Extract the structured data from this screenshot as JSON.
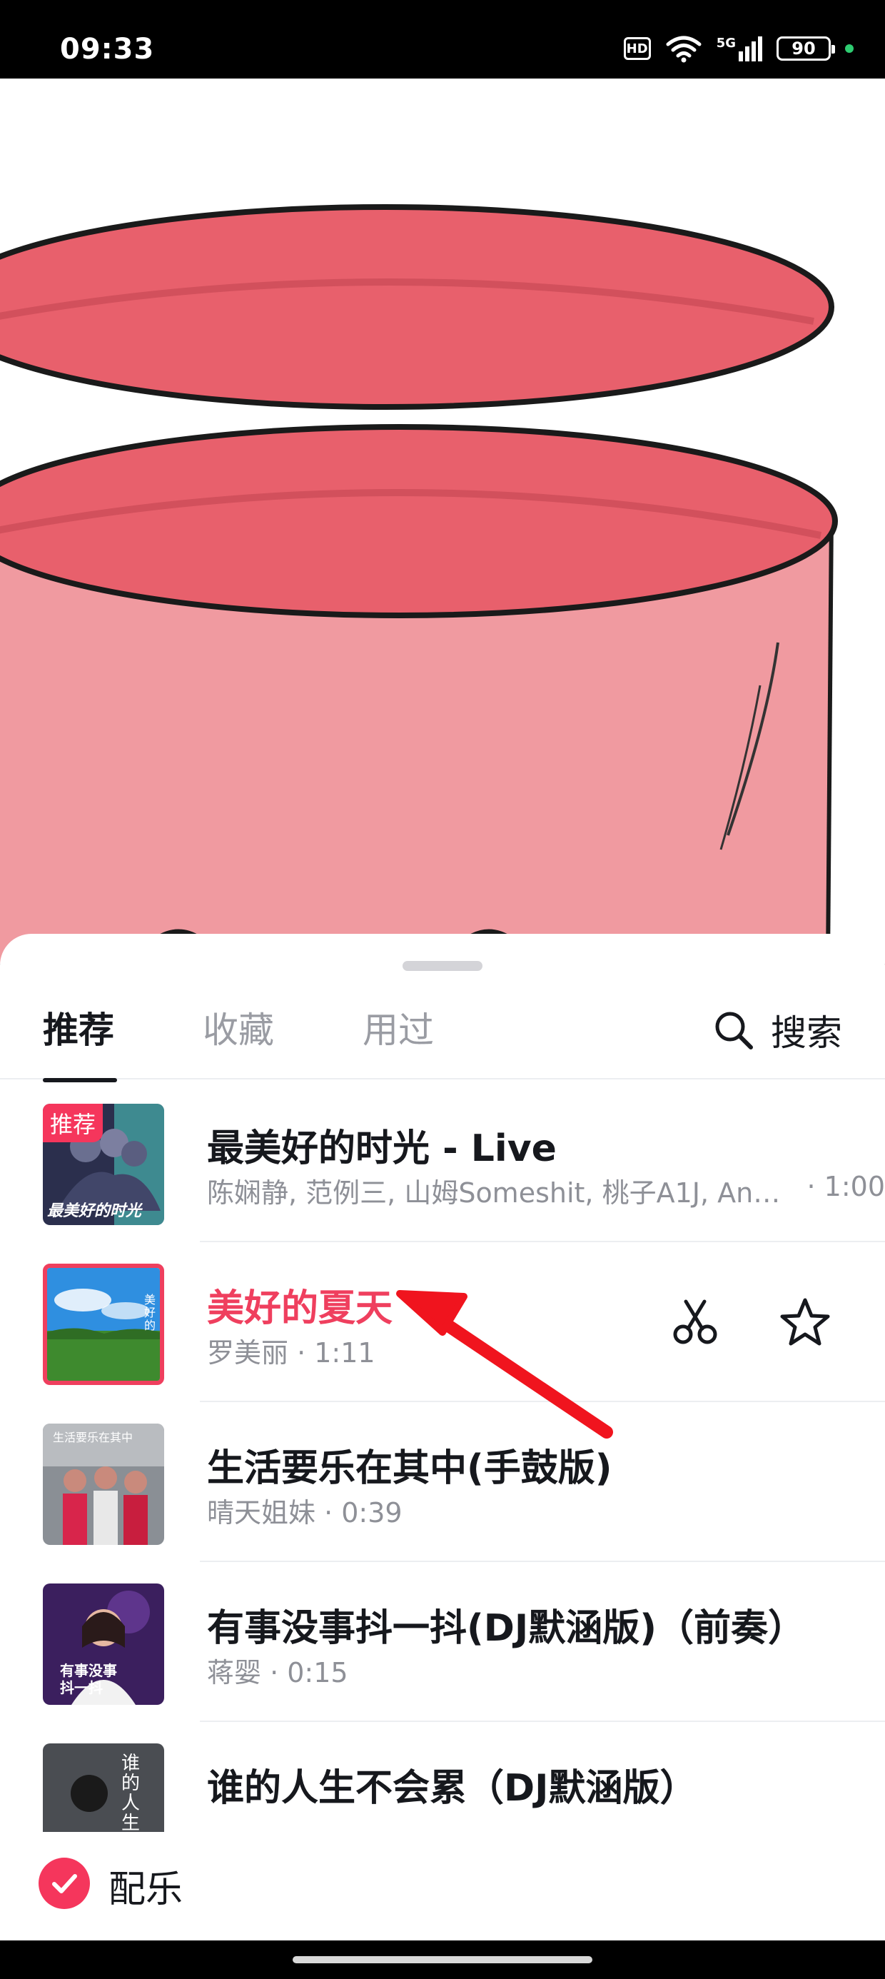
{
  "status_bar": {
    "time": "09:33",
    "hd_label": "HD",
    "network_label": "5G",
    "battery_level": "90",
    "icons": [
      "hd-icon",
      "wifi-icon",
      "cellular-5g-icon",
      "battery-icon"
    ]
  },
  "sheet": {
    "tabs": [
      {
        "label": "推荐",
        "active": true
      },
      {
        "label": "收藏",
        "active": false
      },
      {
        "label": "用过",
        "active": false
      }
    ],
    "search_label": "搜索"
  },
  "songs": [
    {
      "title": "最美好的时光 - Live",
      "subtitle": "陈娴静, 范例三, 山姆Someshit, 桃子A1J, An…",
      "duration_tail": "· 1:00",
      "badge": "推荐",
      "cover_text": "最美好的时光",
      "selected": false
    },
    {
      "title": "美好的夏天",
      "subtitle": "罗美丽 · 1:11",
      "cover_text": "美好的",
      "selected": true,
      "actions": [
        "scissors-icon",
        "star-icon"
      ]
    },
    {
      "title": "生活要乐在其中(手鼓版)",
      "subtitle": "晴天姐妹 · 0:39",
      "cover_text": "生活要乐在其中",
      "selected": false
    },
    {
      "title": "有事没事抖一抖(DJ默涵版)（前奏）",
      "subtitle": "蒋婴 · 0:15",
      "cover_text": "有事没事 抖一抖",
      "selected": false
    },
    {
      "title": "谁的人生不会累（DJ默涵版）",
      "subtitle": "",
      "cover_text": "谁的人生",
      "selected": false
    }
  ],
  "footer": {
    "label": "配乐",
    "checked": true
  },
  "colors": {
    "accent": "#f5365c",
    "selected_text": "#ef3f5e",
    "annotation_arrow": "#f0141e",
    "drum": "#ee6a78"
  }
}
